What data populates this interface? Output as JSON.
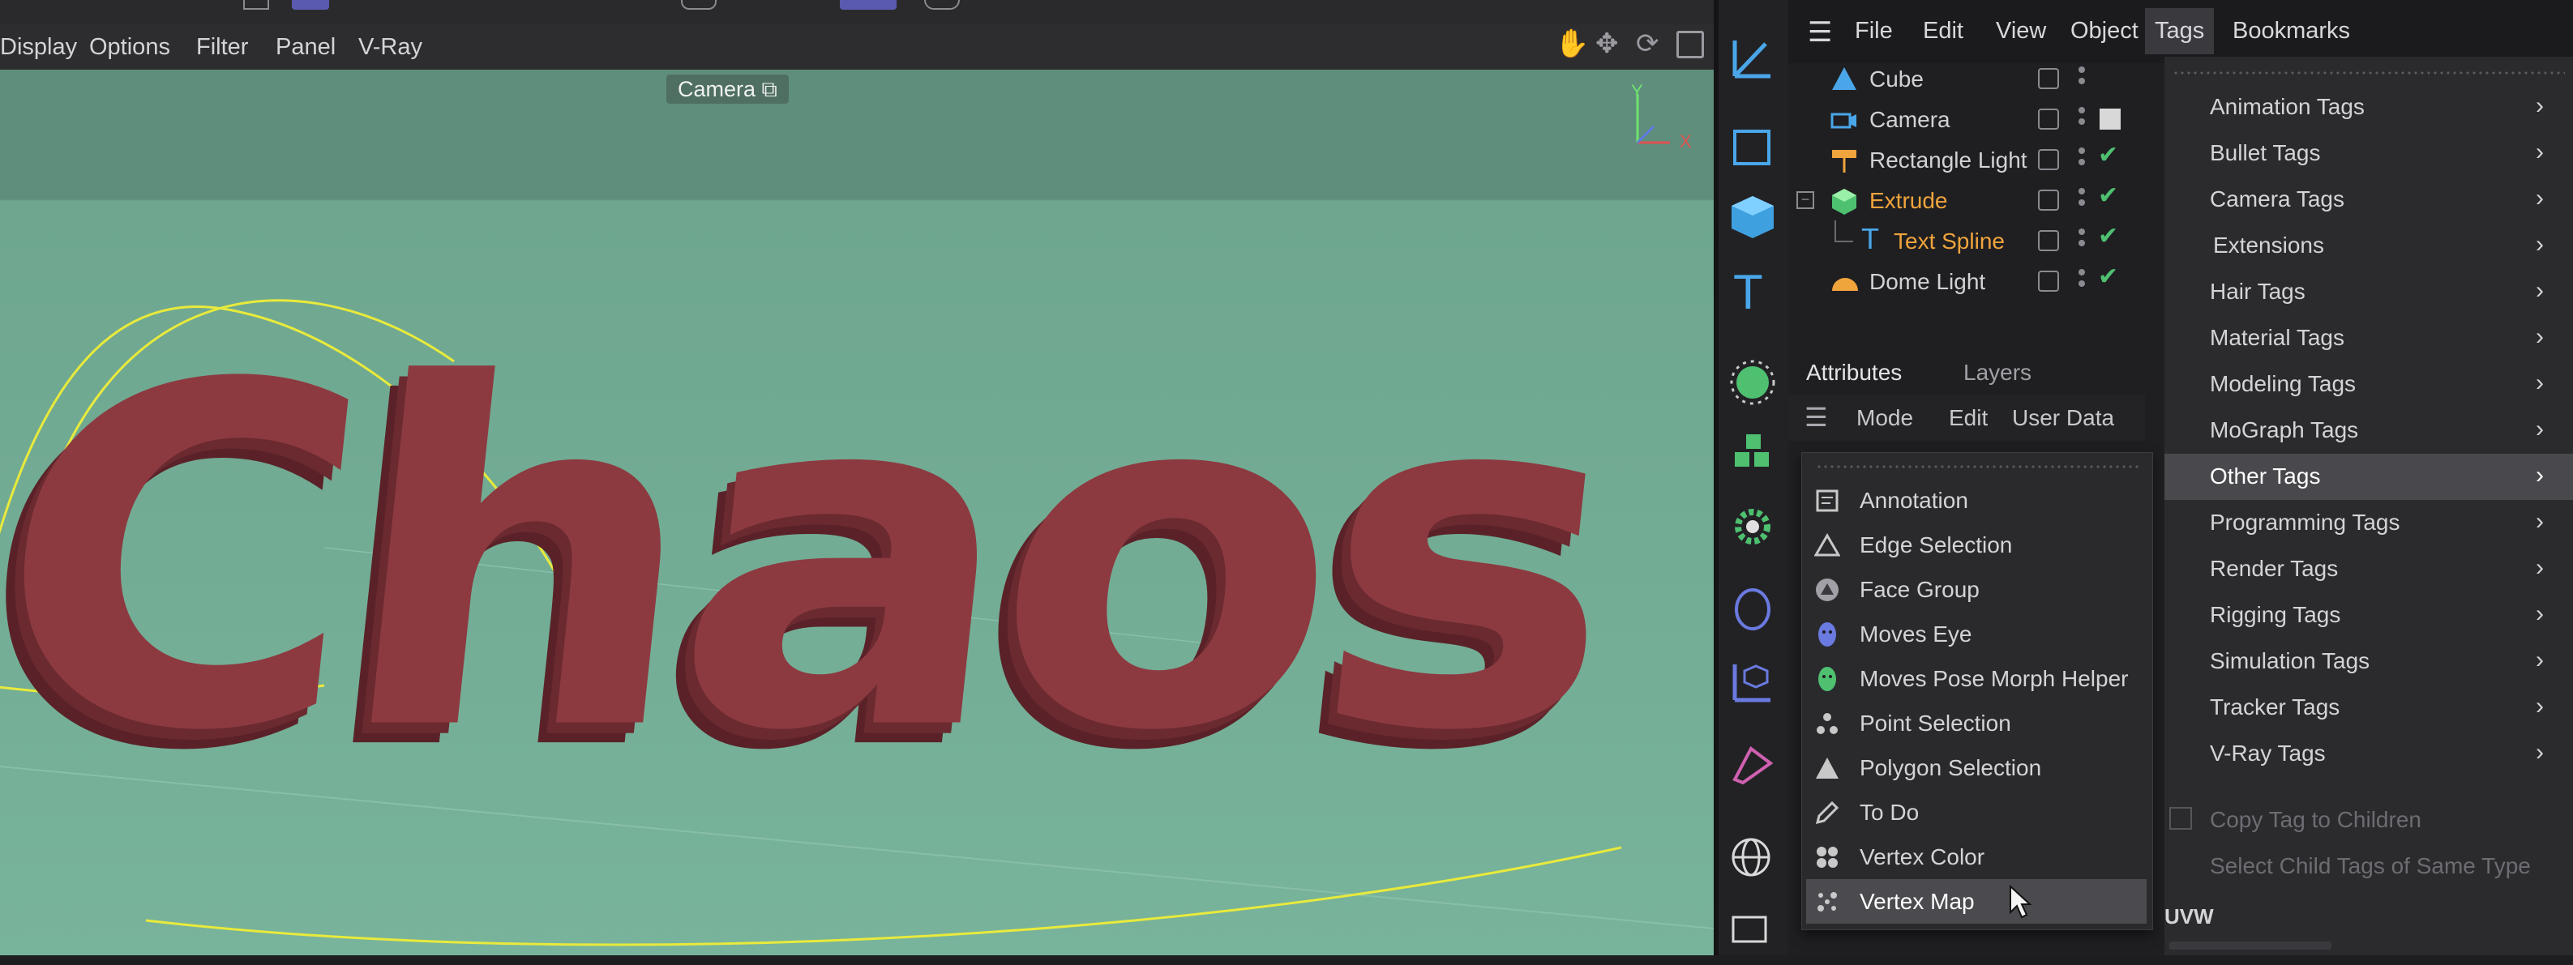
{
  "viewport": {
    "menu": [
      "Display",
      "Options",
      "Filter",
      "Panel",
      "V-Ray"
    ],
    "camera_label": "Camera",
    "axis_labels": {
      "y": "Y",
      "x": "X"
    },
    "scene_text": "Chaos"
  },
  "main_menu": [
    "File",
    "Edit",
    "View",
    "Object",
    "Tags",
    "Bookmarks"
  ],
  "objects": [
    {
      "label": "Cube",
      "icon": "cube-object-icon"
    },
    {
      "label": "Camera",
      "icon": "camera-object-icon"
    },
    {
      "label": "Rectangle Light",
      "icon": "rectangle-light-icon"
    },
    {
      "label": "Extrude",
      "icon": "extrude-object-icon"
    },
    {
      "label": "Text Spline",
      "icon": "text-spline-icon"
    },
    {
      "label": "Dome Light",
      "icon": "dome-light-icon"
    }
  ],
  "attributes": {
    "tabs": [
      "Attributes",
      "Layers"
    ],
    "menu": [
      "Mode",
      "Edit",
      "User Data"
    ]
  },
  "other_tags_submenu": [
    {
      "label": "Annotation",
      "icon": "annotation-icon"
    },
    {
      "label": "Edge Selection",
      "icon": "edge-selection-icon"
    },
    {
      "label": "Face Group",
      "icon": "face-group-icon"
    },
    {
      "label": "Moves Eye",
      "icon": "moves-eye-icon"
    },
    {
      "label": "Moves Pose Morph Helper",
      "icon": "moves-pose-morph-icon"
    },
    {
      "label": "Point Selection",
      "icon": "point-selection-icon"
    },
    {
      "label": "Polygon Selection",
      "icon": "polygon-selection-icon"
    },
    {
      "label": "To Do",
      "icon": "pencil-icon"
    },
    {
      "label": "Vertex Color",
      "icon": "vertex-color-icon"
    },
    {
      "label": "Vertex Map",
      "icon": "vertex-map-icon"
    }
  ],
  "tags_menu": {
    "items": [
      "Animation Tags",
      "Bullet Tags",
      "Camera Tags",
      "Extensions",
      "Hair Tags",
      "Material Tags",
      "Modeling Tags",
      "MoGraph Tags",
      "Other Tags",
      "Programming Tags",
      "Render Tags",
      "Rigging Tags",
      "Simulation Tags",
      "Tracker Tags",
      "V-Ray Tags"
    ],
    "disabled": [
      "Copy Tag to Children",
      "Select Child Tags of Same Type"
    ],
    "section": "UVW"
  },
  "colors": {
    "accent_check": "#4ec070",
    "highlight_orange": "#f0a43c",
    "text_red": "#8c3a40"
  }
}
